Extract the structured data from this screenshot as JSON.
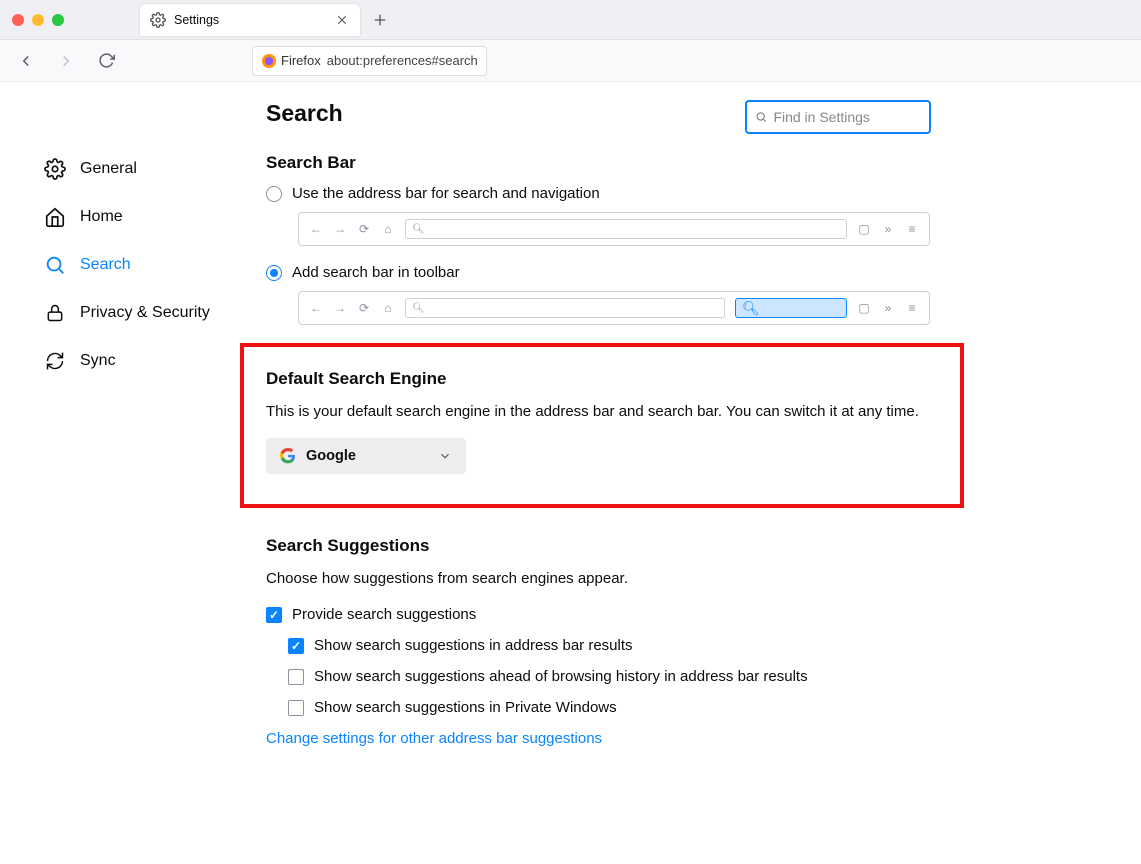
{
  "window": {
    "tab_title": "Settings",
    "url_badge": "Firefox",
    "url": "about:preferences#search"
  },
  "find": {
    "placeholder": "Find in Settings"
  },
  "sidebar": {
    "items": [
      {
        "label": "General"
      },
      {
        "label": "Home"
      },
      {
        "label": "Search"
      },
      {
        "label": "Privacy & Security"
      },
      {
        "label": "Sync"
      }
    ],
    "active_index": 2
  },
  "page": {
    "title": "Search",
    "searchbar_heading": "Search Bar",
    "radio_address": "Use the address bar for search and navigation",
    "radio_toolbar": "Add search bar in toolbar",
    "dse_heading": "Default Search Engine",
    "dse_desc": "This is your default search engine in the address bar and search bar. You can switch it at any time.",
    "engine": "Google",
    "ss_heading": "Search Suggestions",
    "ss_desc": "Choose how suggestions from search engines appear.",
    "chk_provide": "Provide search suggestions",
    "chk_addr": "Show search suggestions in address bar results",
    "chk_hist": "Show search suggestions ahead of browsing history in address bar results",
    "chk_priv": "Show search suggestions in Private Windows",
    "ss_link": "Change settings for other address bar suggestions"
  }
}
